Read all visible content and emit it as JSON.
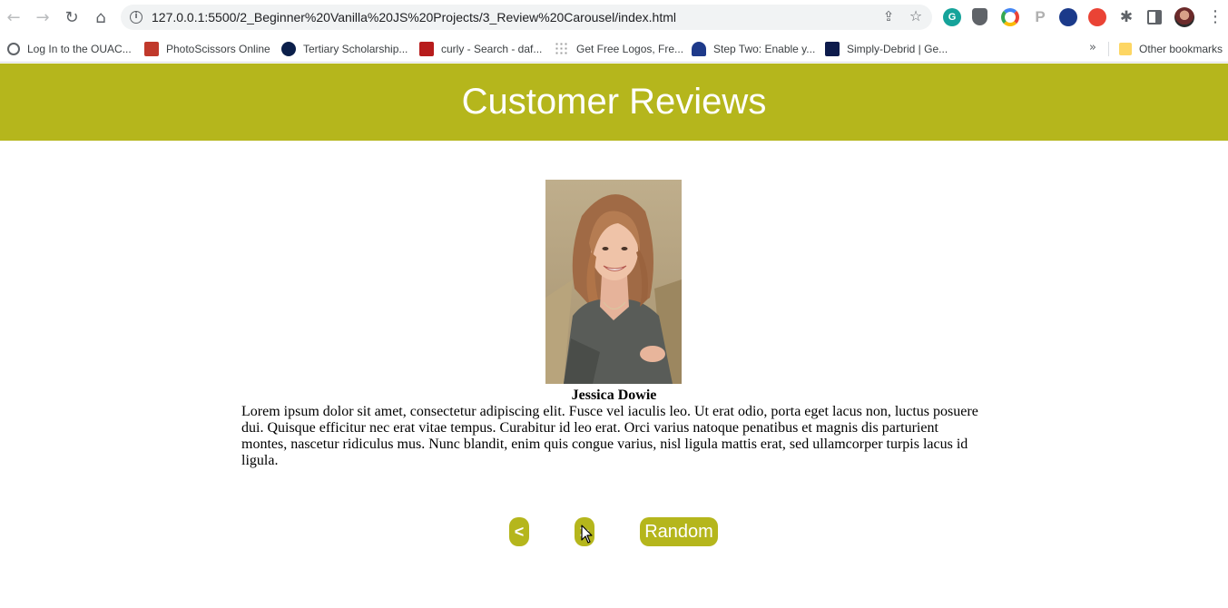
{
  "browser": {
    "url": "127.0.0.1:5500/2_Beginner%20Vanilla%20JS%20Projects/3_Review%20Carousel/index.html",
    "icons": {
      "back": "back-arrow-icon",
      "forward": "forward-arrow-icon",
      "reload": "reload-icon",
      "home": "home-icon",
      "info": "info-icon",
      "share": "share-icon",
      "star": "bookmark-star-icon",
      "menu": "kebab-menu-icon"
    },
    "bookmarks": [
      {
        "label": "Log In to the OUAC...",
        "color": "#5f6368"
      },
      {
        "label": "PhotoScissors Online",
        "color": "#c0392b"
      },
      {
        "label": "Tertiary Scholarship...",
        "color": "#0b1f4a"
      },
      {
        "label": "curly - Search - daf...",
        "color": "#b71c1c"
      },
      {
        "label": "Get Free Logos, Fre...",
        "color": "#9e9e9e"
      },
      {
        "label": "Step Two: Enable y...",
        "color": "#1e3a8a"
      },
      {
        "label": "Simply-Debrid | Ge...",
        "color": "#0d1b4c"
      }
    ],
    "other_bookmarks": "Other bookmarks"
  },
  "page": {
    "title": "Customer Reviews",
    "accent_color": "#b5b61c",
    "review": {
      "name": "Jessica Dowie",
      "text": "Lorem ipsum dolor sit amet, consectetur adipiscing elit. Fusce vel iaculis leo. Ut erat odio, porta eget lacus non, luctus posuere dui. Quisque efficitur nec erat vitae tempus. Curabitur id leo erat. Orci varius natoque penatibus et magnis dis parturient montes, nascetur ridiculus mus. Nunc blandit, enim quis congue varius, nisl ligula mattis erat, sed ullamcorper turpis lacus id ligula."
    },
    "buttons": {
      "prev": "<",
      "next": ">",
      "random": "Random"
    }
  }
}
